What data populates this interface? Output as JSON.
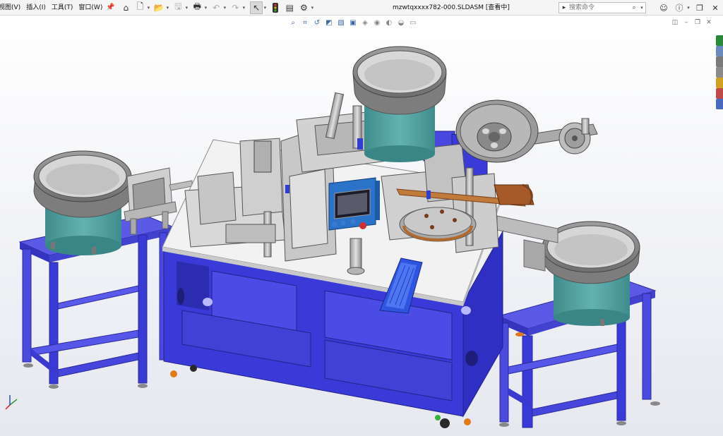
{
  "menu": {
    "items": [
      {
        "label": "视图(V)"
      },
      {
        "label": "插入(I)"
      },
      {
        "label": "工具(T)"
      },
      {
        "label": "窗口(W)"
      }
    ]
  },
  "document": {
    "title": "mzwtqxxxx782-000.SLDASM [查看中]"
  },
  "search": {
    "placeholder": "搜索命令"
  },
  "icons": {
    "pin": "pin-icon",
    "home": "home-icon",
    "new": "new-document-icon",
    "open": "open-folder-icon",
    "save": "save-icon",
    "print": "print-icon",
    "undo": "undo-icon",
    "redo": "redo-icon",
    "select": "select-arrow-icon",
    "traffic": "rebuild-traffic-light-icon",
    "file_props": "file-properties-icon",
    "options": "gear-icon",
    "user": "user-icon",
    "help": "help-icon",
    "restore": "restore-icon",
    "close": "close-icon"
  },
  "colors": {
    "frame_blue": "#3a3ad8",
    "deck_white": "#f0f0f0",
    "bowl_teal": "#4f9e9e",
    "hmi_blue": "#2a73c9",
    "foot_orange": "#e07a1a"
  }
}
